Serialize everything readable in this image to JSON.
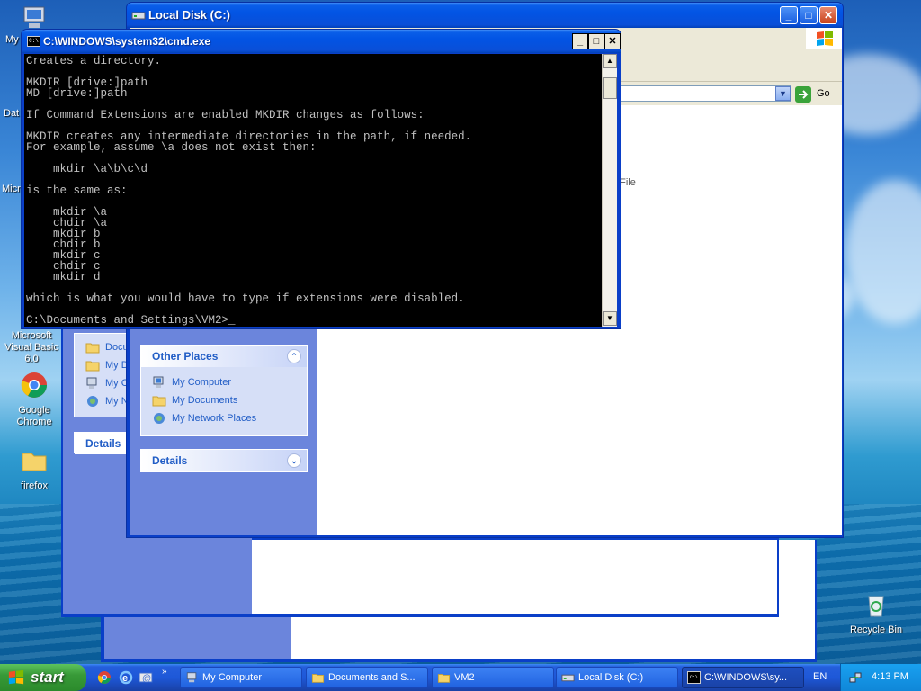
{
  "desktop": {
    "icons": [
      {
        "label": "My"
      },
      {
        "label": "Dat"
      },
      {
        "label": "Micro"
      },
      {
        "label": "Microsoft Visual Basic 6.0"
      },
      {
        "label": "Google Chrome"
      },
      {
        "label": "firefox"
      },
      {
        "label": "Recycle Bin"
      }
    ]
  },
  "explorer_front": {
    "title": "Local Disk (C:)",
    "go_label": "Go",
    "partial_text": "h File",
    "other_places": {
      "heading": "Other Places",
      "links": [
        "My Computer",
        "My Documents",
        "My Network Places"
      ]
    },
    "details_heading": "Details"
  },
  "explorer_back": {
    "links": [
      "Docu",
      "My D",
      "My C",
      "My N"
    ],
    "details_heading": "Details"
  },
  "cmd": {
    "title": "C:\\WINDOWS\\system32\\cmd.exe",
    "lines": [
      "Creates a directory.",
      "",
      "MKDIR [drive:]path",
      "MD [drive:]path",
      "",
      "If Command Extensions are enabled MKDIR changes as follows:",
      "",
      "MKDIR creates any intermediate directories in the path, if needed.",
      "For example, assume \\a does not exist then:",
      "",
      "    mkdir \\a\\b\\c\\d",
      "",
      "is the same as:",
      "",
      "    mkdir \\a",
      "    chdir \\a",
      "    mkdir b",
      "    chdir b",
      "    mkdir c",
      "    chdir c",
      "    mkdir d",
      "",
      "which is what you would have to type if extensions were disabled.",
      "",
      "C:\\Documents and Settings\\VM2>_"
    ]
  },
  "taskbar": {
    "start_label": "start",
    "buttons": [
      {
        "label": "My Computer"
      },
      {
        "label": "Documents and S..."
      },
      {
        "label": "VM2"
      },
      {
        "label": "Local Disk (C:)"
      },
      {
        "label": "C:\\WINDOWS\\sy..."
      }
    ],
    "language": "EN",
    "clock": "4:13 PM"
  }
}
